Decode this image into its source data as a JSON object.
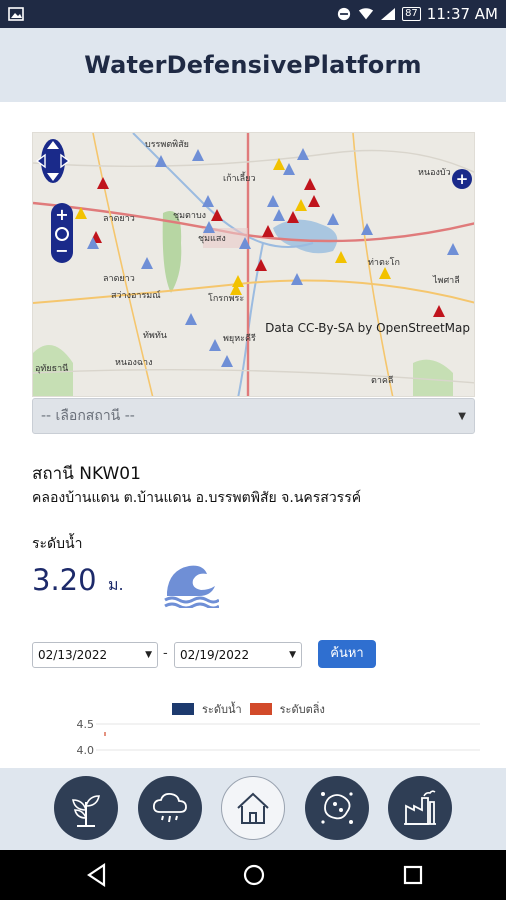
{
  "status_bar": {
    "time": "11:37 AM",
    "battery": "87"
  },
  "app": {
    "title": "WaterDefensivePlatform"
  },
  "map": {
    "attribution": "Data CC-By-SA by OpenStreetMap",
    "place_labels": [
      "บรรพตพิสัย",
      "เก้าเลี้ยว",
      "หนองบัว",
      "ลาดยาว",
      "ชุมตาบง",
      "ชุมแสง",
      "ท่าตะโก",
      "ไพศาลี",
      "สว่างอารมณ์",
      "โกรกพระ",
      "พยุหะคีรี",
      "ลาดยาว",
      "ทัพทัน",
      "หนองฉาง",
      "อุทัยธานี",
      "ตาคลี"
    ],
    "colors": {
      "station_blue": "#6f8fd6",
      "station_red": "#c0141c",
      "station_yellow": "#f2c200",
      "lake": "#a9c6e0",
      "forest": "#b7d6a3",
      "road_red": "#e07b7b",
      "road_orange": "#f5c66d"
    }
  },
  "station_select": {
    "placeholder": "-- เลือกสถานี --"
  },
  "station": {
    "name": "สถานี NKW01",
    "location": "คลองบ้านแดน ต.บ้านแดน อ.บรรพตพิสัย จ.นครสวรรค์"
  },
  "water_level": {
    "label": "ระดับน้ำ",
    "value": "3.20",
    "unit": "ม."
  },
  "date_filter": {
    "from": "02/13/2022",
    "separator": "-",
    "to": "02/19/2022",
    "search_label": "ค้นหา"
  },
  "chart_data": {
    "type": "line",
    "series": [
      {
        "name": "ระดับน้ำ",
        "color": "#1d3a6e",
        "values": []
      },
      {
        "name": "ระดับตลิ่ง",
        "color": "#d24a2a",
        "values": []
      }
    ],
    "y_ticks": [
      "4.5",
      "4.0"
    ],
    "grid": true
  },
  "bottom_nav": {
    "items": [
      "plant-icon",
      "rain-cloud-icon",
      "home-icon",
      "virus-icon",
      "factory-icon"
    ],
    "active": "home-icon"
  }
}
